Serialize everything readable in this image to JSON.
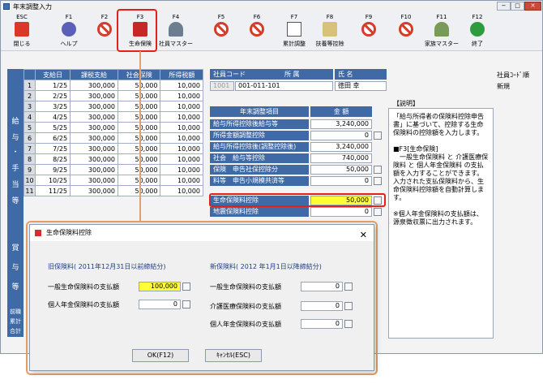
{
  "window": {
    "title": "年末調整入力",
    "min": "−",
    "max": "□",
    "close": "✕"
  },
  "toolbar": [
    {
      "key": "ESC",
      "label": "閉じる",
      "icon": "close-x-icon",
      "name": "close"
    },
    {
      "key": "F1",
      "label": "ヘルプ",
      "icon": "help-icon",
      "name": "help"
    },
    {
      "key": "F2",
      "label": "",
      "icon": "no-entry-icon",
      "name": "f2"
    },
    {
      "key": "F3",
      "label": "生命保険",
      "icon": "life-insurance-icon",
      "name": "life-insurance"
    },
    {
      "key": "F4",
      "label": "社員マスター",
      "icon": "employee-icon",
      "name": "employee-master"
    },
    {
      "key": "F5",
      "label": "",
      "icon": "no-entry-icon",
      "name": "f5"
    },
    {
      "key": "F6",
      "label": "",
      "icon": "no-entry-icon",
      "name": "f6"
    },
    {
      "key": "F7",
      "label": "累計調整",
      "icon": "edit-icon",
      "name": "cumulative"
    },
    {
      "key": "F8",
      "label": "扶養等控除",
      "icon": "dependents-icon",
      "name": "dependents"
    },
    {
      "key": "F9",
      "label": "",
      "icon": "no-entry-icon",
      "name": "f9"
    },
    {
      "key": "F10",
      "label": "",
      "icon": "no-entry-icon",
      "name": "f10"
    },
    {
      "key": "F11",
      "label": "家族マスター",
      "icon": "family-icon",
      "name": "family-master"
    },
    {
      "key": "F12",
      "label": "終了",
      "icon": "check-icon",
      "name": "finish"
    }
  ],
  "side_groups": [
    "給",
    "与",
    "・",
    "手",
    "当",
    "等",
    "賞",
    "与",
    "等"
  ],
  "grid": {
    "headers": [
      "支給日",
      "課税支給",
      "社会保険",
      "所得税額"
    ],
    "rows": [
      {
        "n": "1",
        "date": "1/25",
        "pay": "300,000",
        "ins": "50,000",
        "tax": "10,000"
      },
      {
        "n": "2",
        "date": "2/25",
        "pay": "300,000",
        "ins": "50,000",
        "tax": "10,000"
      },
      {
        "n": "3",
        "date": "3/25",
        "pay": "300,000",
        "ins": "50,000",
        "tax": "10,000"
      },
      {
        "n": "4",
        "date": "4/25",
        "pay": "300,000",
        "ins": "50,000",
        "tax": "10,000"
      },
      {
        "n": "5",
        "date": "5/25",
        "pay": "300,000",
        "ins": "50,000",
        "tax": "10,000"
      },
      {
        "n": "6",
        "date": "6/25",
        "pay": "300,000",
        "ins": "50,000",
        "tax": "10,000"
      },
      {
        "n": "7",
        "date": "7/25",
        "pay": "300,000",
        "ins": "50,000",
        "tax": "10,000"
      },
      {
        "n": "8",
        "date": "8/25",
        "pay": "300,000",
        "ins": "50,000",
        "tax": "10,000"
      },
      {
        "n": "9",
        "date": "9/25",
        "pay": "300,000",
        "ins": "50,000",
        "tax": "10,000"
      },
      {
        "n": "10",
        "date": "10/25",
        "pay": "300,000",
        "ins": "50,000",
        "tax": "10,000"
      },
      {
        "n": "11",
        "date": "11/25",
        "pay": "300,000",
        "ins": "50,000",
        "tax": "10,000"
      }
    ]
  },
  "employee": {
    "code_header": "社員コード",
    "dept_header": "所 属",
    "name_header": "氏 名",
    "code_prefix": "1001",
    "code": "001-011-101",
    "name": "徳田 幸",
    "right_label": "社員ｺｰﾄﾞ順",
    "right_value": "新規"
  },
  "items": {
    "col_name": "年末調整項目",
    "col_amount": "金 額",
    "rows": [
      {
        "name": "給与所得控除後給与等",
        "value": "3,240,000",
        "calc": false
      },
      {
        "name": "所得金額調整控除",
        "value": "0",
        "calc": true
      },
      {
        "name": "給与所得控除後(調整控除後)",
        "value": "3,240,000",
        "calc": false
      },
      {
        "name": "社会　給与等控除",
        "value": "740,000",
        "calc": false
      },
      {
        "name": "保険　申告社保控除分",
        "value": "50,000",
        "calc": true
      },
      {
        "name": "料等　申告小規模共済等",
        "value": "0",
        "calc": true
      },
      {
        "name": "生命保険料控除",
        "value": "50,000",
        "calc": true,
        "highlight": true
      },
      {
        "name": "地震保険料控除",
        "value": "0",
        "calc": true
      }
    ]
  },
  "explain": {
    "label": "【説明】",
    "text": "「給与所得者の保険料控除申告書」に基づいて、控除する生命保険料の控除額を入力します。\n\n■F3[生命保険]\n　一般生命保険料 と 介護医療保険料 と 個人年金保険料 の支払額を入力することができます。\n入力された支払保険料から、生命保険料控除額を自動計算します。\n\n※個人年金保険料の支払額は、源泉徴収票に出力されます。"
  },
  "dialog": {
    "title": "生命保険料控除",
    "close": "✕",
    "old_section": "旧保険料( 2011年12月31日以前締結分)",
    "new_section": "新保険料( 2012 年1月1日以降締結分)",
    "old_fields": [
      {
        "label": "一般生命保険料の支払額",
        "value": "100,000",
        "highlight": true
      },
      {
        "label": "個人年金保険料の支払額",
        "value": "0"
      }
    ],
    "new_fields": [
      {
        "label": "一般生命保険料の支払額",
        "value": "0"
      },
      {
        "label": "介護医療保険料の支払額",
        "value": "0"
      },
      {
        "label": "個人年金保険料の支払額",
        "value": "0"
      }
    ],
    "ok": "OK(F12)",
    "cancel": "ｷｬﾝｾﾙ(ESC)"
  },
  "bottom_labels": [
    "前職",
    "累計",
    "合計"
  ]
}
